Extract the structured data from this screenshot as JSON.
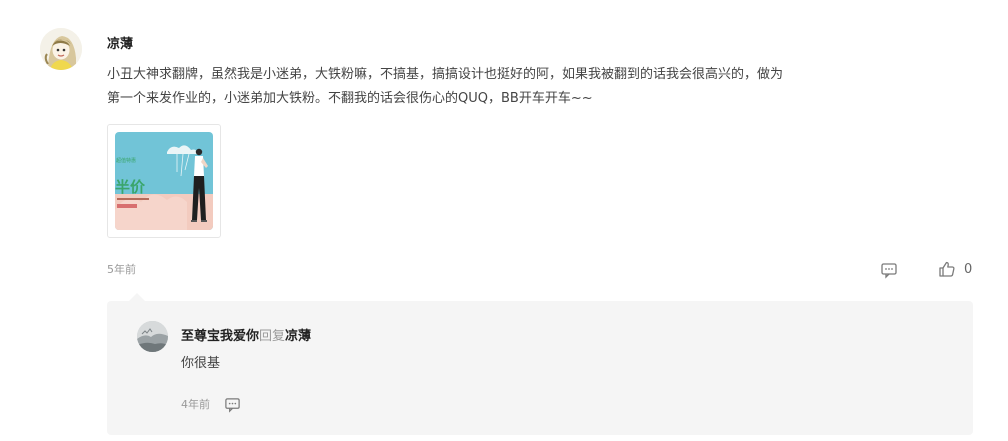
{
  "comment": {
    "author": "凉薄",
    "text": "小丑大神求翻牌，虽然我是小迷弟，大铁粉嘛，不搞基，搞搞设计也挺好的阿，如果我被翻到的话我会很高兴的，做为第一个来发作业的，小迷弟加大铁粉。不翻我的话会很伤心的QUQ，BB开车开车~~",
    "time": "5年前",
    "like_count": "0",
    "avatar_icon": "cartoon-avatar",
    "thumbnail": {
      "icon": "poster-thumbnail",
      "poster_text": "半价",
      "colors": {
        "sky": "#6fc4d6",
        "cloud": "#f3c9bd",
        "accent": "#3aa56b"
      }
    }
  },
  "reply": {
    "author": "至尊宝我爱你",
    "reply_word": "回复",
    "target": "凉薄",
    "text": "你很基",
    "time": "4年前",
    "avatar_icon": "landscape-avatar"
  },
  "icons": {
    "reply": "comment-bubble-icon",
    "like": "thumbs-up-icon"
  },
  "colors": {
    "reply_background": "#f5f5f5",
    "meta_text": "#999999"
  }
}
